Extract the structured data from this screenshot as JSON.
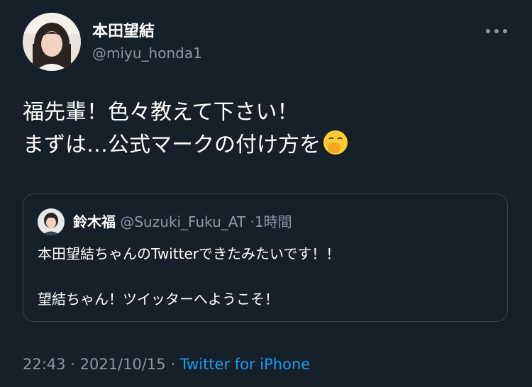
{
  "tweet": {
    "author": {
      "display_name": "本田望結",
      "handle": "@miyu_honda1"
    },
    "text_lines": [
      "福先輩！色々教えて下さい！",
      "まずは…公式マークの付け方を"
    ],
    "emoji": "face-with-hand-over-mouth-icon",
    "quoted_tweet": {
      "display_name": "鈴木福",
      "handle": "@Suzuki_Fuku_AT",
      "separator": "·",
      "time": "1時間",
      "text_lines": [
        "本田望結ちゃんのTwitterできたみたいです！！",
        "望結ちゃん！ツイッターへようこそ！"
      ]
    },
    "time": "22:43",
    "separator": "·",
    "date": "2021/10/15",
    "source": "Twitter for iPhone"
  },
  "colors": {
    "background": "#15202b",
    "text_primary": "#ffffff",
    "text_secondary": "#8b98a5",
    "link": "#1d9bf0",
    "border": "#38444d",
    "emoji": "#ffcc33"
  }
}
